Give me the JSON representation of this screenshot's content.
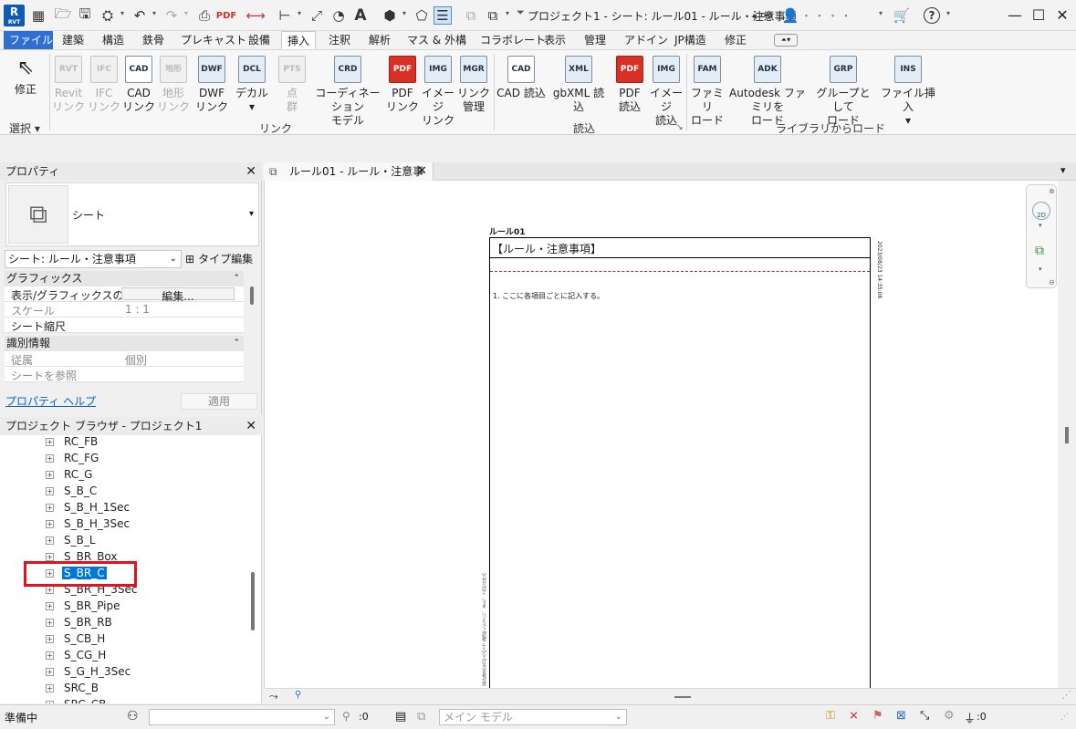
{
  "app": {
    "logo": "R",
    "logo_sub": "RVT",
    "title": "プロジェクト1 - シート: ルール01 - ルール・注意事項"
  },
  "quick_access": [
    "folder-open-icon",
    "save-icon",
    "sync-icon",
    "undo-icon",
    "redo-icon",
    "print-icon",
    "pdf-export-icon",
    "measure-icon",
    "dimension-icon",
    "tag-icon",
    "text-icon",
    "3d-view-icon",
    "section-icon",
    "thin-lines-icon",
    "close-hidden-icon",
    "switch-windows-icon"
  ],
  "title_right": {
    "user_name": "・ ・ ・ ・"
  },
  "tabs": [
    "ファイル",
    "建築",
    "構造",
    "鉄骨",
    "プレキャスト",
    "設備",
    "挿入",
    "注釈",
    "解析",
    "マス & 外構",
    "コラボレート",
    "表示",
    "管理",
    "アドイン",
    "JP構造",
    "修正"
  ],
  "active_tab": "挿入",
  "ribbon": {
    "modify": {
      "label1": "修正"
    },
    "select_label": "選択",
    "link": {
      "title": "リンク",
      "buttons": [
        {
          "l1": "Revit",
          "l2": "リンク",
          "icon": "RVT",
          "disabled": true
        },
        {
          "l1": "IFC",
          "l2": "リンク",
          "icon": "IFC",
          "disabled": true
        },
        {
          "l1": "CAD",
          "l2": "リンク",
          "icon": "CAD",
          "disabled": false
        },
        {
          "l1": "地形",
          "l2": "リンク",
          "icon": "地形",
          "disabled": true
        },
        {
          "l1": "DWF",
          "l2": "リンク",
          "icon": "DWF",
          "disabled": false
        },
        {
          "l1": "デカル",
          "l2": "▾",
          "icon": "DCL",
          "disabled": false
        },
        {
          "l1": "点",
          "l2": "群",
          "icon": "PTS",
          "disabled": true
        },
        {
          "l1": "コーディネーション",
          "l2": "モデル",
          "icon": "CRD",
          "disabled": false
        },
        {
          "l1": "PDF",
          "l2": "リンク",
          "icon": "PDF",
          "disabled": false
        },
        {
          "l1": "イメージ",
          "l2": "リンク",
          "icon": "IMG",
          "disabled": false
        },
        {
          "l1": "リンク",
          "l2": "管理",
          "icon": "MGR",
          "disabled": false
        }
      ]
    },
    "import": {
      "title": "読込",
      "buttons": [
        {
          "l1": "CAD 読込",
          "l2": "",
          "icon": "CAD"
        },
        {
          "l1": "gbXML 読込",
          "l2": "",
          "icon": "XML"
        },
        {
          "l1": "PDF",
          "l2": "読込",
          "icon": "PDF"
        },
        {
          "l1": "イメージ",
          "l2": "読込",
          "icon": "IMG"
        }
      ]
    },
    "library": {
      "title": "ライブラリからロード",
      "buttons": [
        {
          "l1": "ファミリ",
          "l2": "ロード",
          "icon": "FAM"
        },
        {
          "l1": "Autodesk ファミリを",
          "l2": "ロード",
          "icon": "ADK"
        },
        {
          "l1": "グループとして",
          "l2": "ロード",
          "icon": "GRP"
        },
        {
          "l1": "ファイル挿入",
          "l2": "▾",
          "icon": "INS"
        }
      ]
    }
  },
  "properties": {
    "title": "プロパティ",
    "type_name": "シート",
    "selector_value": "シート: ルール・注意事項",
    "type_edit": "タイプ編集",
    "groups": [
      {
        "name": "グラフィックス",
        "rows": [
          {
            "k": "表示/グラフィックスの...",
            "v": "編集..."
          },
          {
            "k": "スケール",
            "v": "1 : 1"
          },
          {
            "k": "シート縮尺",
            "v": ""
          }
        ]
      },
      {
        "name": "識別情報",
        "rows": [
          {
            "k": "従属",
            "v": "個別"
          },
          {
            "k": "シートを参照",
            "v": ""
          }
        ]
      }
    ],
    "help_link": "プロパティ ヘルプ",
    "apply": "適用"
  },
  "browser": {
    "title": "プロジェクト ブラウザ - プロジェクト1",
    "items": [
      "RC_FB",
      "RC_FG",
      "RC_G",
      "S_B_C",
      "S_B_H_1Sec",
      "S_B_H_3Sec",
      "S_B_L",
      "S_BR_Box",
      "S_BR_C",
      "S_BR_H_3Sec",
      "S_BR_Pipe",
      "S_BR_RB",
      "S_CB_H",
      "S_CG_H",
      "S_G_H_3Sec",
      "SRC_B",
      "SRC_CB"
    ],
    "selected": "S_BR_C"
  },
  "view_tab": {
    "label": "ルール01 - ルール・注意事項"
  },
  "sheet": {
    "label": "ルール01",
    "heading": "【ルール・注意事項】",
    "item1": "1. ここに各項目ごとに記入する。",
    "side_date": "2023/08/23 14:35:06",
    "side_note": "設計者名を記入の上ご確認ください、また、上記以外の場合は担当者まで連絡ください。"
  },
  "status": {
    "text": "準備中",
    "workset": "メイン モデル",
    "count": ":0",
    "filter_count": ":0"
  },
  "colors": {
    "file_tab": "#2f6fd1",
    "selected": "#0078d7",
    "highlight_box": "#e0141a",
    "dash_line": "#c0262c"
  }
}
